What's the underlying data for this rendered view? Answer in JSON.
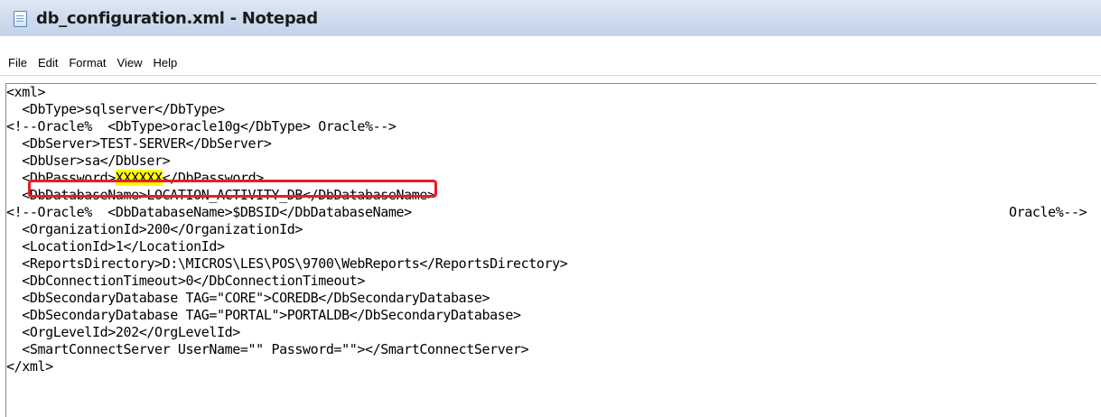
{
  "window": {
    "title": "db_configuration.xml - Notepad"
  },
  "menu": [
    "File",
    "Edit",
    "Format",
    "View",
    "Help"
  ],
  "editor": {
    "lines": [
      "<xml>",
      "  <DbType>sqlserver</DbType>",
      "<!--Oracle%  <DbType>oracle10g</DbType> Oracle%-->",
      "  <DbServer>TEST-SERVER</DbServer>",
      "  <DbUser>sa</DbUser>",
      "  <DbPassword>",
      "  <DbDatabaseName>LOCATION_ACTIVITY_DB</DbDatabaseName>",
      "<!--Oracle%  <DbDatabaseName>$DBSID</DbDatabaseName>",
      "  <OrganizationId>200</OrganizationId>",
      "  <LocationId>1</LocationId>",
      "  <ReportsDirectory>D:\\MICROS\\LES\\POS\\9700\\WebReports</ReportsDirectory>",
      "  <DbConnectionTimeout>0</DbConnectionTimeout>",
      "  <DbSecondaryDatabase TAG=\"CORE\">COREDB</DbSecondaryDatabase>",
      "  <DbSecondaryDatabase TAG=\"PORTAL\">PORTALDB</DbSecondaryDatabase>",
      "  <OrgLevelId>202</OrgLevelId>",
      "  <SmartConnectServer UserName=\"\" Password=\"\"></SmartConnectServer>",
      "</xml>"
    ],
    "password_value": "XXXXXX",
    "password_close": "</DbPassword>",
    "line8_trailing": "Oracle%-->"
  },
  "colors": {
    "highlight_box": "#e81e25",
    "selection_fill": "#ffff00"
  },
  "icons": {
    "app": "notepad-icon"
  }
}
